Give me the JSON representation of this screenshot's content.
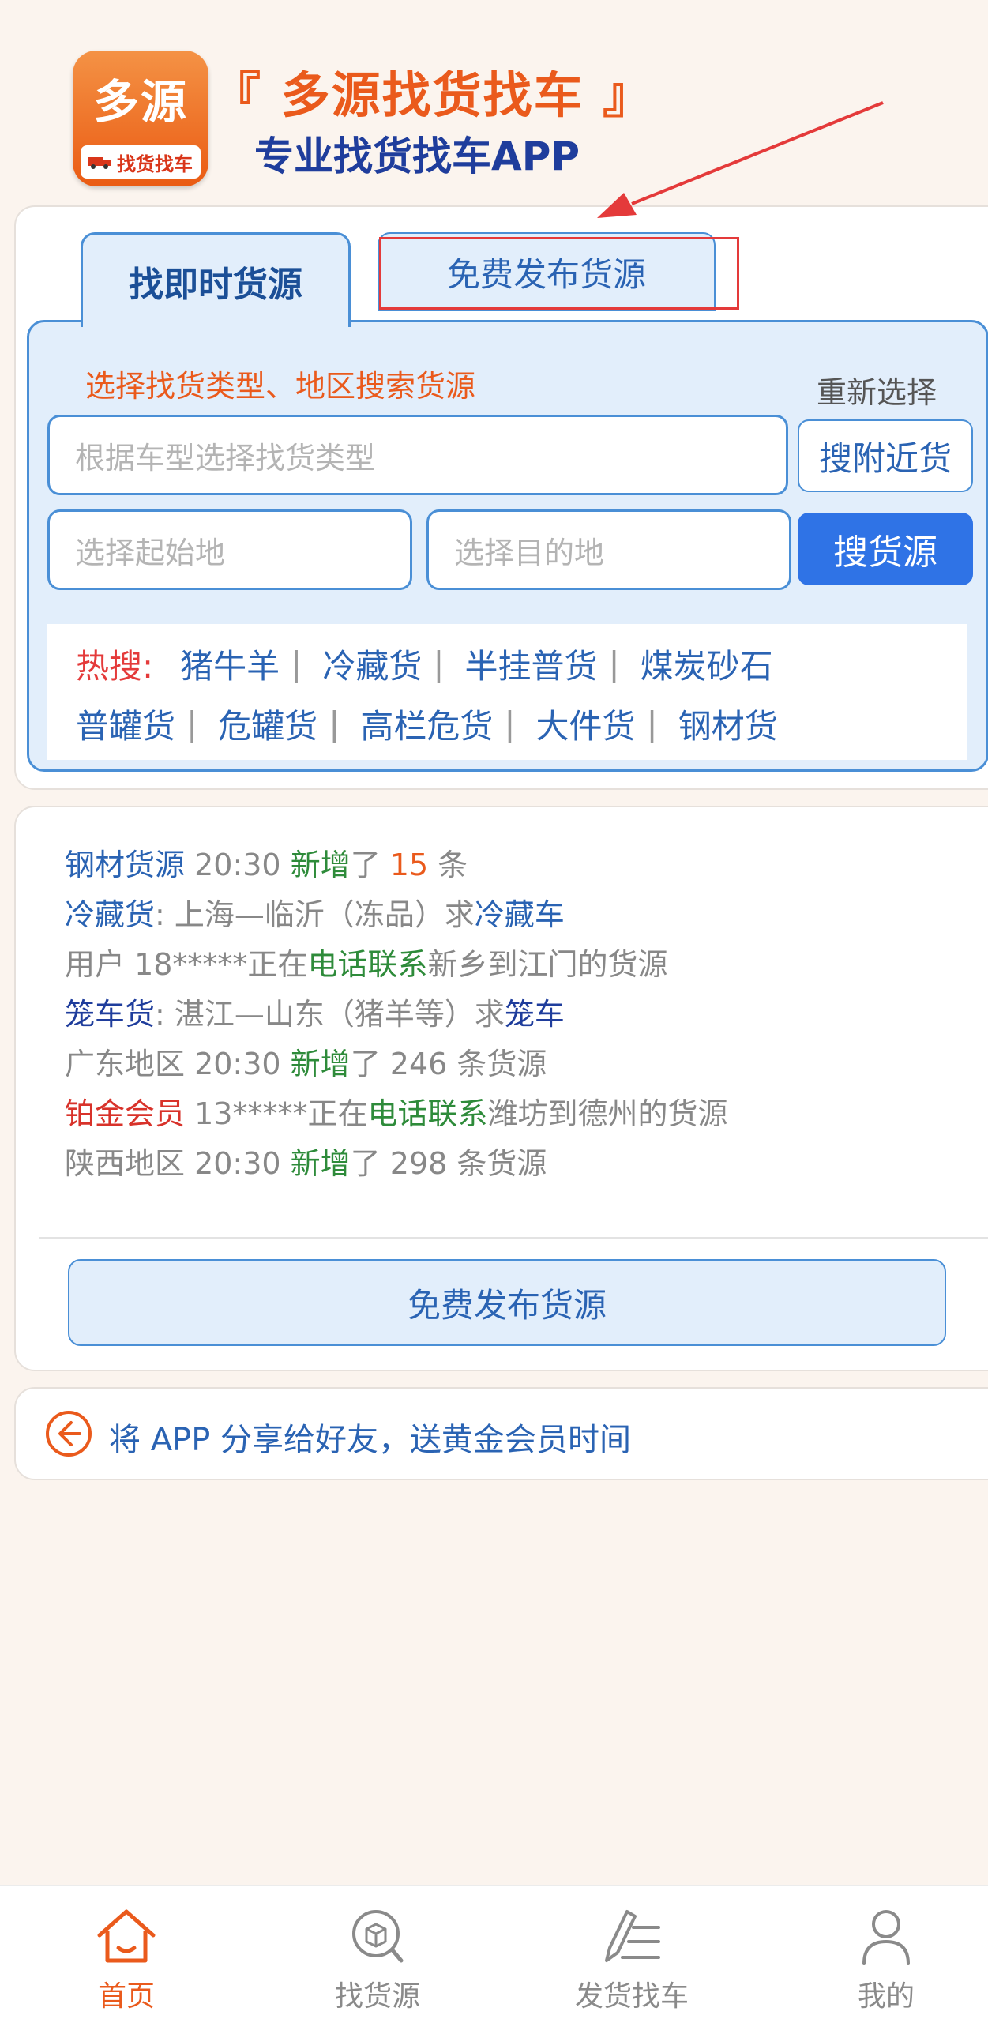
{
  "header": {
    "logo_text": "多源",
    "logo_sub": "找货找车",
    "brand_title": "『 多源找货找车 』",
    "brand_subtitle": "专业找货找车APP"
  },
  "tabs": {
    "active_label": "找即时货源",
    "free_label": "免费发布货源"
  },
  "search": {
    "hint": "选择找货类型、地区搜索货源",
    "reselect": "重新选择",
    "type_placeholder": "根据车型选择找货类型",
    "near_button": "搜附近货",
    "from_placeholder": "选择起始地",
    "to_placeholder": "选择目的地",
    "search_button": "搜货源"
  },
  "hot": {
    "label": "热搜:",
    "row1": [
      "猪牛羊",
      "冷藏货",
      "半挂普货",
      "煤炭砂石"
    ],
    "row2": [
      "普罐货",
      "危罐货",
      "高栏危货",
      "大件货",
      "钢材货"
    ]
  },
  "feed": {
    "l1": {
      "a": "钢材货源",
      "b": " 20:30 ",
      "c": "新增",
      "d": "了 ",
      "e": "15",
      "f": " 条"
    },
    "l2": {
      "a": "冷藏货",
      "b": ": 上海—临沂（冻品）求",
      "c": "冷藏车"
    },
    "l3": {
      "a": "用户 18*****正在",
      "b": "电话联系",
      "c": "新乡到江门的货源"
    },
    "l4": {
      "a": "笼车货",
      "b": ": 湛江—山东（猪羊等）求",
      "c": "笼车"
    },
    "l5": {
      "a": "广东地区 20:30 ",
      "b": "新增",
      "c": "了 246 条货源"
    },
    "l6": {
      "a": "铂金会员",
      "b": " 13*****正在",
      "c": "电话联系",
      "d": "潍坊到德州的货源"
    },
    "l7": {
      "a": "陕西地区 20:30 ",
      "b": "新增",
      "c": "了 298 条货源"
    },
    "button": "免费发布货源"
  },
  "share": {
    "text": "将 APP 分享给好友，送黄金会员时间"
  },
  "nav": {
    "home": "首页",
    "find_goods": "找货源",
    "ship": "发货找车",
    "mine": "我的"
  },
  "colors": {
    "accent_orange": "#ea5a1c",
    "primary_blue": "#2f73e6",
    "panel_blue": "#e2eefb",
    "annotation_red": "#e43a3a"
  }
}
